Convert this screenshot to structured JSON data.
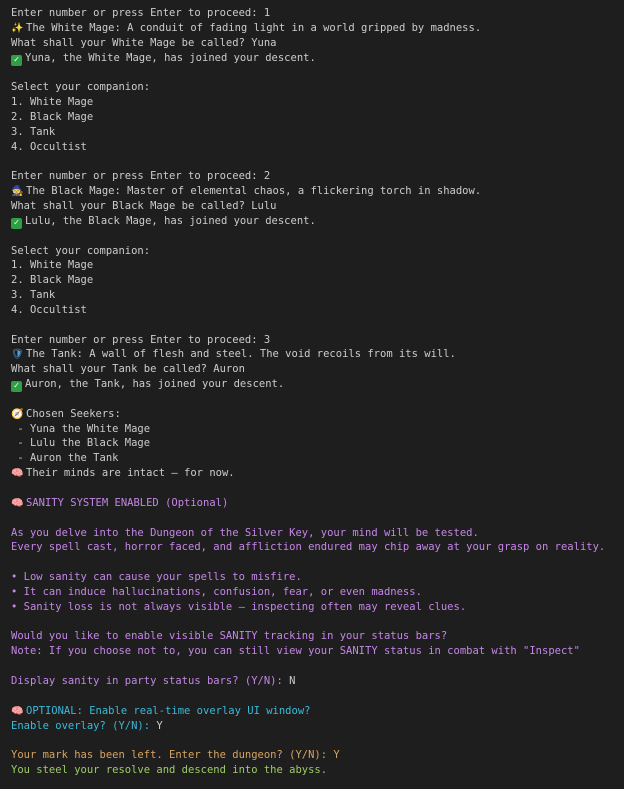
{
  "terminal": {
    "prompt_1": "Enter number or press Enter to proceed: 1",
    "white_mage_desc": "The White Mage: A conduit of fading light in a world gripped by madness.",
    "white_mage_name_prompt": "What shall your White Mage be called? Yuna",
    "white_mage_joined": "Yuna, the White Mage, has joined your descent.",
    "select_companion_1": "Select your companion:",
    "companions_1": [
      "1. White Mage",
      "2. Black Mage",
      "3. Tank",
      "4. Occultist"
    ],
    "prompt_2": "Enter number or press Enter to proceed: 2",
    "black_mage_desc": "The Black Mage: Master of elemental chaos, a flickering torch in shadow.",
    "black_mage_name_prompt": "What shall your Black Mage be called? Lulu",
    "black_mage_joined": "Lulu, the Black Mage, has joined your descent.",
    "select_companion_2": "Select your companion:",
    "companions_2": [
      "1. White Mage",
      "2. Black Mage",
      "3. Tank",
      "4. Occultist"
    ],
    "prompt_3": "Enter number or press Enter to proceed: 3",
    "tank_desc": "The Tank: A wall of flesh and steel. The void recoils from its will.",
    "tank_name_prompt": "What shall your Tank be called? Auron",
    "tank_joined": "Auron, the Tank, has joined your descent.",
    "chosen_seekers_title": "Chosen Seekers:",
    "seekers": [
      " - Yuna the White Mage",
      " - Lulu the Black Mage",
      " - Auron the Tank"
    ],
    "minds_intact": "Their minds are intact — for now.",
    "sanity_system": "SANITY SYSTEM ENABLED (Optional)",
    "sanity_intro_1": "As you delve into the Dungeon of the Silver Key, your mind will be tested.",
    "sanity_intro_2": "Every spell cast, horror faced, and affliction endured may chip away at your grasp on reality.",
    "sanity_bullets": [
      "• Low sanity can cause your spells to misfire.",
      "• It can induce hallucinations, confusion, fear, or even madness.",
      "• Sanity loss is not always visible — inspecting often may reveal clues."
    ],
    "sanity_question": "Would you like to enable visible SANITY tracking in your status bars?",
    "sanity_note": "Note: If you choose not to, you can still view your SANITY status in combat with \"Inspect\"",
    "display_sanity_prompt": "Display sanity in party status bars? (Y/N): ",
    "display_sanity_answer": "N",
    "overlay_optional": "OPTIONAL: Enable real-time overlay UI window?",
    "overlay_prompt": "Enable overlay? (Y/N): ",
    "overlay_answer": "Y",
    "enter_dungeon_prompt": "Your mark has been left. Enter the dungeon? (Y/N): ",
    "enter_dungeon_answer": "Y",
    "descend": "You steel your resolve and descend into the abyss."
  },
  "icons": {
    "sparkle": "sparkle-icon",
    "black_mage": "mage-icon",
    "shield": "shield-icon",
    "compass": "compass-icon",
    "brain": "brain-icon",
    "check": "check-icon"
  },
  "colors": {
    "background": "#1e1e1e",
    "text": "#cccccc",
    "purple": "#c586e8",
    "cyan": "#3bb9d8",
    "orange": "#d7a35f",
    "green": "#9ccc65",
    "check_green": "#2ea043"
  }
}
